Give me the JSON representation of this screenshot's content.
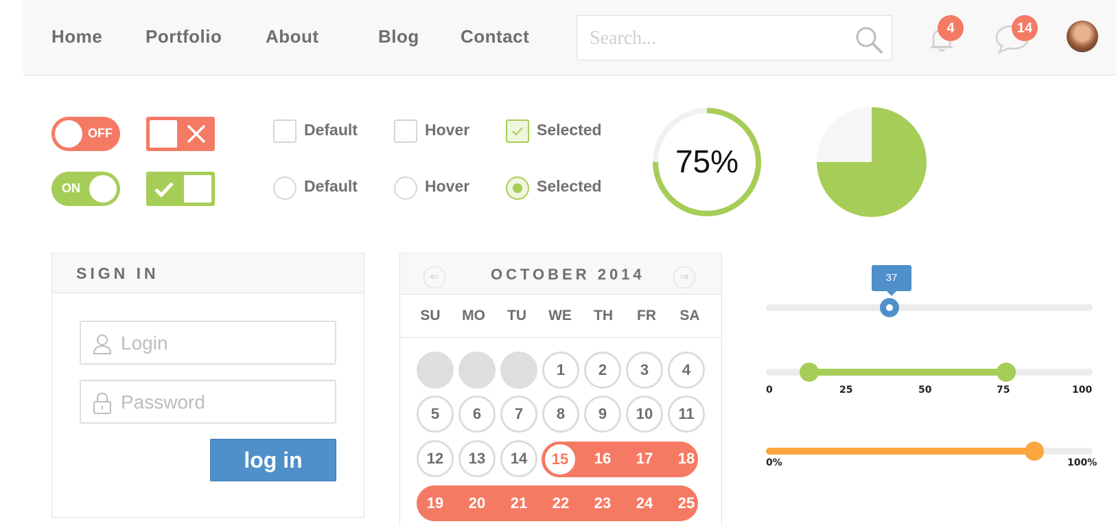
{
  "nav": {
    "items": [
      "Home",
      "Portfolio",
      "About",
      "Blog",
      "Contact"
    ]
  },
  "search": {
    "placeholder": "Search..."
  },
  "notifications": {
    "count": "4"
  },
  "messages": {
    "count": "14"
  },
  "toggles": {
    "off_label": "OFF",
    "on_label": "ON"
  },
  "options": {
    "checkbox_default": "Default",
    "checkbox_hover": "Hover",
    "checkbox_selected": "Selected",
    "radio_default": "Default",
    "radio_hover": "Hover",
    "radio_selected": "Selected"
  },
  "progress": {
    "text": "75%",
    "value": 0.75
  },
  "pie": {
    "value": 0.75
  },
  "signin": {
    "title": "SIGN IN",
    "login_placeholder": "Login",
    "password_placeholder": "Password",
    "button": "log in"
  },
  "calendar": {
    "title": "OCTOBER 2014",
    "prev_icon": "⇐",
    "next_icon": "⇒",
    "weekdays": [
      "SU",
      "MO",
      "TU",
      "WE",
      "TH",
      "FR",
      "SA"
    ],
    "days": [
      "1",
      "2",
      "3",
      "4",
      "5",
      "6",
      "7",
      "8",
      "9",
      "10",
      "11",
      "12",
      "13",
      "14",
      "15",
      "16",
      "17",
      "18",
      "19",
      "20",
      "21",
      "22",
      "23",
      "24",
      "25"
    ],
    "today": "15"
  },
  "slider1": {
    "value": "37",
    "fraction": 0.37
  },
  "slider2": {
    "ticks": [
      "0",
      "25",
      "50",
      "75",
      "100"
    ],
    "low": 13,
    "high": 74
  },
  "slider3": {
    "min_label": "0%",
    "max_label": "100%",
    "fraction": 0.82
  },
  "colors": {
    "green": "#a6cd57",
    "coral": "#f57a64",
    "blue": "#4f8fca",
    "orange": "#f9a73e"
  }
}
